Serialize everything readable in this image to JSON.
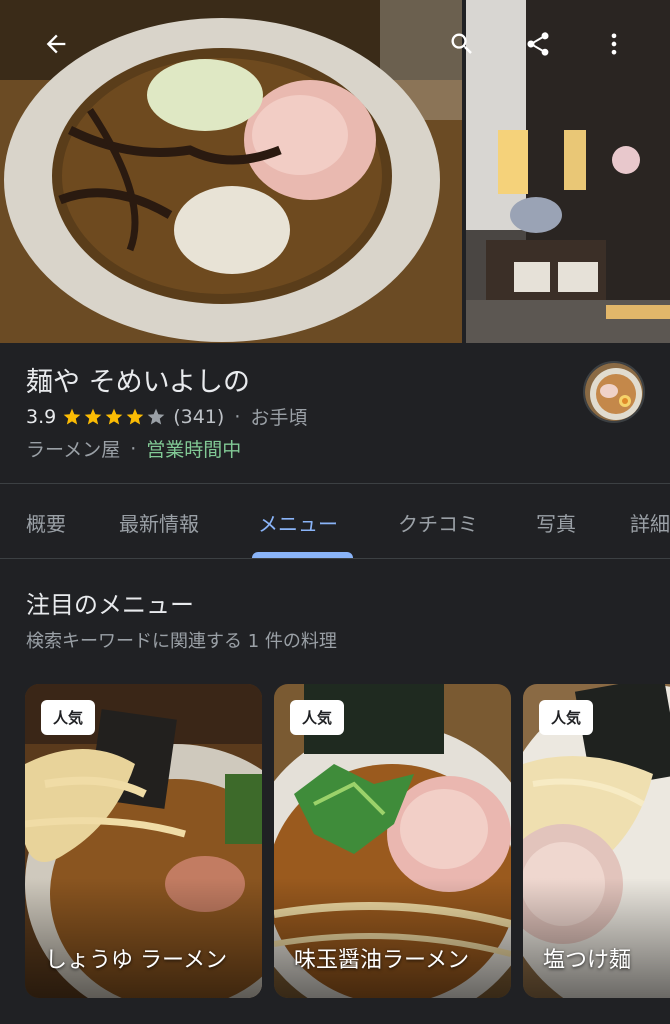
{
  "place": {
    "name": "麺や そめいよしの",
    "rating": "3.9",
    "stars_filled": 4,
    "reviews": "(341)",
    "price": "お手頃",
    "category": "ラーメン屋",
    "open_status": "営業時間中"
  },
  "tabs": [
    {
      "label": "概要"
    },
    {
      "label": "最新情報"
    },
    {
      "label": "メニュー",
      "active": true
    },
    {
      "label": "クチコミ"
    },
    {
      "label": "写真"
    },
    {
      "label": "詳細"
    }
  ],
  "menu_section": {
    "title": "注目のメニュー",
    "subtitle": "検索キーワードに関連する 1 件の料理"
  },
  "menu_items": [
    {
      "badge": "人気",
      "name": "しょうゆ ラーメン"
    },
    {
      "badge": "人気",
      "name": "味玉醤油ラーメン"
    },
    {
      "badge": "人気",
      "name": "塩つけ麺"
    }
  ],
  "icons": {
    "back": "back-arrow-icon",
    "search": "search-icon",
    "share": "share-icon",
    "more": "more-vert-icon"
  },
  "colors": {
    "background": "#202124",
    "accent": "#8ab4f8",
    "star": "#fbbc04",
    "open": "#81c995"
  }
}
